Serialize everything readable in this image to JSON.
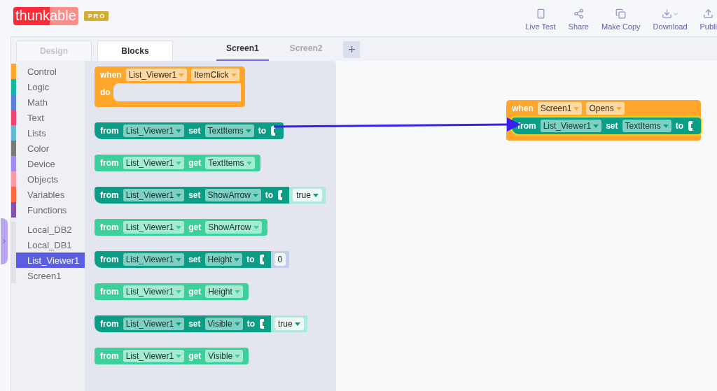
{
  "header": {
    "logo": {
      "part_1": "thunk",
      "part_2": "able"
    },
    "badge": "PRO",
    "actions": [
      {
        "kind": "live-test",
        "label": "Live Test"
      },
      {
        "kind": "share",
        "label": "Share"
      },
      {
        "kind": "copy",
        "label": "Make Copy"
      },
      {
        "kind": "download",
        "label": "Download"
      },
      {
        "kind": "publish",
        "label": "Publi"
      }
    ]
  },
  "mode_tabs": [
    {
      "label": "Design",
      "selected": false
    },
    {
      "label": "Blocks",
      "selected": true
    }
  ],
  "screen_tabs": [
    {
      "label": "Screen1",
      "selected": true
    },
    {
      "label": "Screen2",
      "selected": false
    }
  ],
  "add_screen_button": "+",
  "categories": [
    {
      "label": "Control",
      "color": "#ffa62b"
    },
    {
      "label": "Logic",
      "color": "#13b8a0"
    },
    {
      "label": "Math",
      "color": "#5b80d6"
    },
    {
      "label": "Text",
      "color": "#f0436e"
    },
    {
      "label": "Lists",
      "color": "#67b8d6"
    },
    {
      "label": "Color",
      "color": "#7a7a7a"
    },
    {
      "label": "Device",
      "color": "#a08cf0"
    },
    {
      "label": "Objects",
      "color": "#ff9aa2"
    },
    {
      "label": "Variables",
      "color": "#ff6640"
    },
    {
      "label": "Functions",
      "color": "#7f53ac"
    }
  ],
  "components": [
    {
      "label": "Local_DB2",
      "selected": false
    },
    {
      "label": "Local_DB1",
      "selected": false
    },
    {
      "label": "List_Viewer1",
      "selected": true
    },
    {
      "label": "Screen1",
      "selected": false
    }
  ],
  "flyout_blocks": [
    {
      "kind": "event",
      "tokens": [
        {
          "kind": "label",
          "text": "when"
        },
        {
          "kind": "dropdown",
          "text": "List_Viewer1"
        },
        {
          "kind": "dropdown",
          "text": "ItemClick"
        }
      ],
      "do_label": "do"
    },
    {
      "kind": "setter",
      "tokens": [
        {
          "kind": "label",
          "text": "from"
        },
        {
          "kind": "dropdown",
          "text": "List_Viewer1"
        },
        {
          "kind": "label",
          "text": "set"
        },
        {
          "kind": "dropdown",
          "text": "TextItems"
        },
        {
          "kind": "label",
          "text": "to"
        }
      ]
    },
    {
      "kind": "getter",
      "tokens": [
        {
          "kind": "label",
          "text": "from"
        },
        {
          "kind": "dropdown",
          "text": "List_Viewer1"
        },
        {
          "kind": "label",
          "text": "get"
        },
        {
          "kind": "dropdown",
          "text": "TextItems"
        }
      ]
    },
    {
      "kind": "setter",
      "tokens": [
        {
          "kind": "label",
          "text": "from"
        },
        {
          "kind": "dropdown",
          "text": "List_Viewer1"
        },
        {
          "kind": "label",
          "text": "set"
        },
        {
          "kind": "dropdown",
          "text": "ShowArrow"
        },
        {
          "kind": "label",
          "text": "to"
        }
      ],
      "value": {
        "kind": "logic",
        "text": "true"
      }
    },
    {
      "kind": "getter",
      "tokens": [
        {
          "kind": "label",
          "text": "from"
        },
        {
          "kind": "dropdown",
          "text": "List_Viewer1"
        },
        {
          "kind": "label",
          "text": "get"
        },
        {
          "kind": "dropdown",
          "text": "ShowArrow"
        }
      ]
    },
    {
      "kind": "setter",
      "tokens": [
        {
          "kind": "label",
          "text": "from"
        },
        {
          "kind": "dropdown",
          "text": "List_Viewer1"
        },
        {
          "kind": "label",
          "text": "set"
        },
        {
          "kind": "dropdown",
          "text": "Height"
        },
        {
          "kind": "label",
          "text": "to"
        }
      ],
      "value": {
        "kind": "math",
        "text": "0"
      }
    },
    {
      "kind": "getter",
      "tokens": [
        {
          "kind": "label",
          "text": "from"
        },
        {
          "kind": "dropdown",
          "text": "List_Viewer1"
        },
        {
          "kind": "label",
          "text": "get"
        },
        {
          "kind": "dropdown",
          "text": "Height"
        }
      ]
    },
    {
      "kind": "setter",
      "tokens": [
        {
          "kind": "label",
          "text": "from"
        },
        {
          "kind": "dropdown",
          "text": "List_Viewer1"
        },
        {
          "kind": "label",
          "text": "set"
        },
        {
          "kind": "dropdown",
          "text": "Visible"
        },
        {
          "kind": "label",
          "text": "to"
        }
      ],
      "value": {
        "kind": "logic",
        "text": "true"
      }
    },
    {
      "kind": "getter",
      "tokens": [
        {
          "kind": "label",
          "text": "from"
        },
        {
          "kind": "dropdown",
          "text": "List_Viewer1"
        },
        {
          "kind": "label",
          "text": "get"
        },
        {
          "kind": "dropdown",
          "text": "Visible"
        }
      ]
    }
  ],
  "workspace_blocks": [
    {
      "kind": "event",
      "tokens": [
        {
          "kind": "label",
          "text": "when"
        },
        {
          "kind": "dropdown",
          "text": "Screen1"
        },
        {
          "kind": "dropdown",
          "text": "Opens"
        }
      ],
      "body": {
        "kind": "setter",
        "selected": true,
        "tokens": [
          {
            "kind": "label",
            "text": "from"
          },
          {
            "kind": "dropdown",
            "text": "List_Viewer1"
          },
          {
            "kind": "label",
            "text": "set"
          },
          {
            "kind": "dropdown",
            "text": "TextItems"
          },
          {
            "kind": "label",
            "text": "to"
          }
        ]
      }
    }
  ]
}
